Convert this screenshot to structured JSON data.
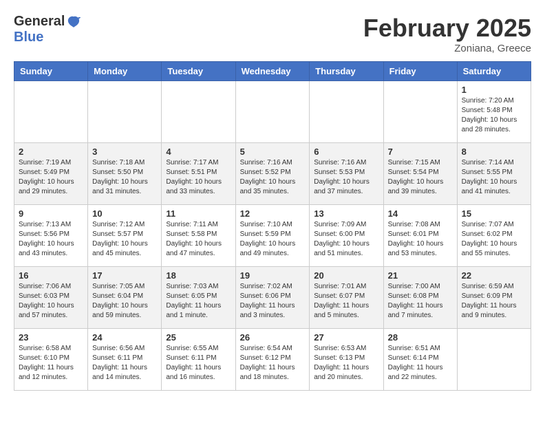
{
  "header": {
    "logo_general": "General",
    "logo_blue": "Blue",
    "month_title": "February 2025",
    "location": "Zoniana, Greece"
  },
  "days_of_week": [
    "Sunday",
    "Monday",
    "Tuesday",
    "Wednesday",
    "Thursday",
    "Friday",
    "Saturday"
  ],
  "weeks": [
    [
      {
        "day": "",
        "info": ""
      },
      {
        "day": "",
        "info": ""
      },
      {
        "day": "",
        "info": ""
      },
      {
        "day": "",
        "info": ""
      },
      {
        "day": "",
        "info": ""
      },
      {
        "day": "",
        "info": ""
      },
      {
        "day": "1",
        "info": "Sunrise: 7:20 AM\nSunset: 5:48 PM\nDaylight: 10 hours and 28 minutes."
      }
    ],
    [
      {
        "day": "2",
        "info": "Sunrise: 7:19 AM\nSunset: 5:49 PM\nDaylight: 10 hours and 29 minutes."
      },
      {
        "day": "3",
        "info": "Sunrise: 7:18 AM\nSunset: 5:50 PM\nDaylight: 10 hours and 31 minutes."
      },
      {
        "day": "4",
        "info": "Sunrise: 7:17 AM\nSunset: 5:51 PM\nDaylight: 10 hours and 33 minutes."
      },
      {
        "day": "5",
        "info": "Sunrise: 7:16 AM\nSunset: 5:52 PM\nDaylight: 10 hours and 35 minutes."
      },
      {
        "day": "6",
        "info": "Sunrise: 7:16 AM\nSunset: 5:53 PM\nDaylight: 10 hours and 37 minutes."
      },
      {
        "day": "7",
        "info": "Sunrise: 7:15 AM\nSunset: 5:54 PM\nDaylight: 10 hours and 39 minutes."
      },
      {
        "day": "8",
        "info": "Sunrise: 7:14 AM\nSunset: 5:55 PM\nDaylight: 10 hours and 41 minutes."
      }
    ],
    [
      {
        "day": "9",
        "info": "Sunrise: 7:13 AM\nSunset: 5:56 PM\nDaylight: 10 hours and 43 minutes."
      },
      {
        "day": "10",
        "info": "Sunrise: 7:12 AM\nSunset: 5:57 PM\nDaylight: 10 hours and 45 minutes."
      },
      {
        "day": "11",
        "info": "Sunrise: 7:11 AM\nSunset: 5:58 PM\nDaylight: 10 hours and 47 minutes."
      },
      {
        "day": "12",
        "info": "Sunrise: 7:10 AM\nSunset: 5:59 PM\nDaylight: 10 hours and 49 minutes."
      },
      {
        "day": "13",
        "info": "Sunrise: 7:09 AM\nSunset: 6:00 PM\nDaylight: 10 hours and 51 minutes."
      },
      {
        "day": "14",
        "info": "Sunrise: 7:08 AM\nSunset: 6:01 PM\nDaylight: 10 hours and 53 minutes."
      },
      {
        "day": "15",
        "info": "Sunrise: 7:07 AM\nSunset: 6:02 PM\nDaylight: 10 hours and 55 minutes."
      }
    ],
    [
      {
        "day": "16",
        "info": "Sunrise: 7:06 AM\nSunset: 6:03 PM\nDaylight: 10 hours and 57 minutes."
      },
      {
        "day": "17",
        "info": "Sunrise: 7:05 AM\nSunset: 6:04 PM\nDaylight: 10 hours and 59 minutes."
      },
      {
        "day": "18",
        "info": "Sunrise: 7:03 AM\nSunset: 6:05 PM\nDaylight: 11 hours and 1 minute."
      },
      {
        "day": "19",
        "info": "Sunrise: 7:02 AM\nSunset: 6:06 PM\nDaylight: 11 hours and 3 minutes."
      },
      {
        "day": "20",
        "info": "Sunrise: 7:01 AM\nSunset: 6:07 PM\nDaylight: 11 hours and 5 minutes."
      },
      {
        "day": "21",
        "info": "Sunrise: 7:00 AM\nSunset: 6:08 PM\nDaylight: 11 hours and 7 minutes."
      },
      {
        "day": "22",
        "info": "Sunrise: 6:59 AM\nSunset: 6:09 PM\nDaylight: 11 hours and 9 minutes."
      }
    ],
    [
      {
        "day": "23",
        "info": "Sunrise: 6:58 AM\nSunset: 6:10 PM\nDaylight: 11 hours and 12 minutes."
      },
      {
        "day": "24",
        "info": "Sunrise: 6:56 AM\nSunset: 6:11 PM\nDaylight: 11 hours and 14 minutes."
      },
      {
        "day": "25",
        "info": "Sunrise: 6:55 AM\nSunset: 6:11 PM\nDaylight: 11 hours and 16 minutes."
      },
      {
        "day": "26",
        "info": "Sunrise: 6:54 AM\nSunset: 6:12 PM\nDaylight: 11 hours and 18 minutes."
      },
      {
        "day": "27",
        "info": "Sunrise: 6:53 AM\nSunset: 6:13 PM\nDaylight: 11 hours and 20 minutes."
      },
      {
        "day": "28",
        "info": "Sunrise: 6:51 AM\nSunset: 6:14 PM\nDaylight: 11 hours and 22 minutes."
      },
      {
        "day": "",
        "info": ""
      }
    ]
  ]
}
